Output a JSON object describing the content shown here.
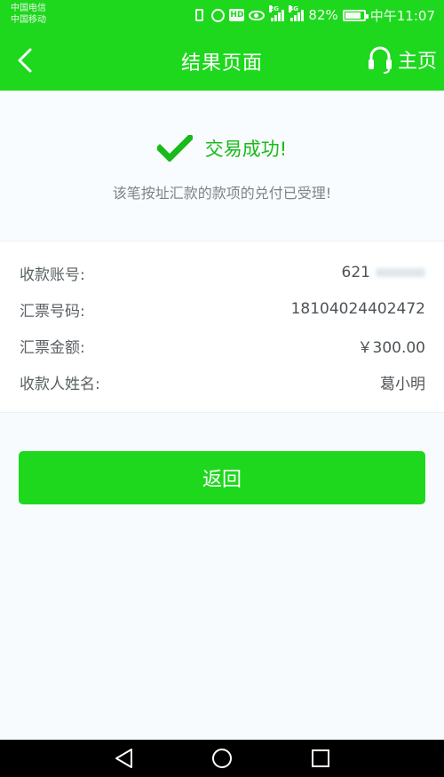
{
  "status_bar": {
    "carrier_1": "中国电信",
    "carrier_2": "中国移动",
    "network_1": "2G",
    "network_2": "4G",
    "battery": "82%",
    "time": "中午11:07"
  },
  "header": {
    "title": "结果页面",
    "home_label": "主页"
  },
  "result": {
    "title": "交易成功!",
    "description": "该笔按址汇款的款项的兑付已受理!"
  },
  "details": [
    {
      "label": "收款账号:",
      "value": "621"
    },
    {
      "label": "汇票号码:",
      "value": "18104024402472"
    },
    {
      "label": "汇票金额:",
      "value": "￥300.00"
    },
    {
      "label": "收款人姓名:",
      "value": "葛小明"
    }
  ],
  "actions": {
    "return_label": "返回"
  },
  "colors": {
    "brand_green": "#1ed81e",
    "success_green": "#19ba19"
  }
}
